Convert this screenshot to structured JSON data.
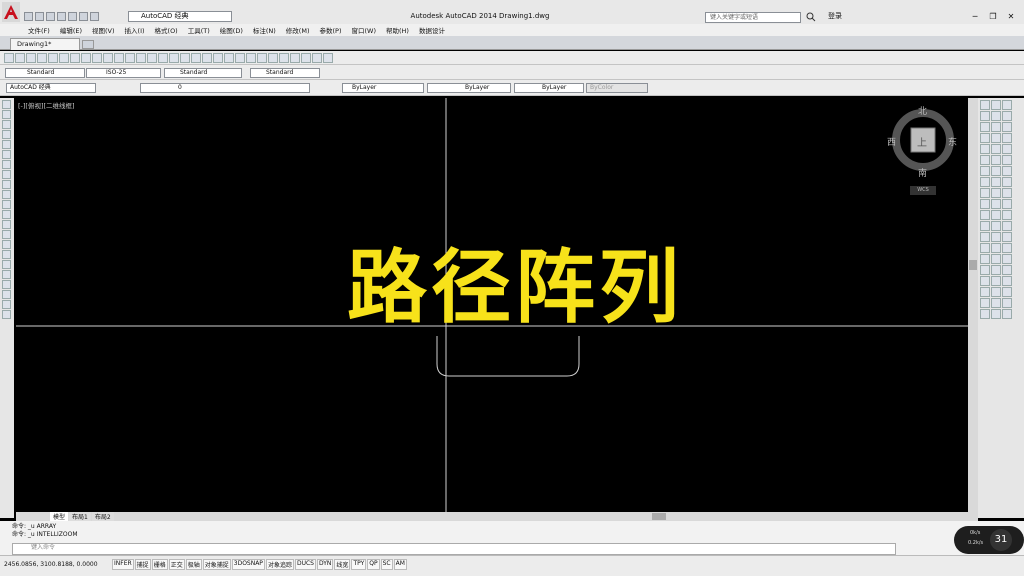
{
  "window": {
    "title": "Autodesk AutoCAD 2014    Drawing1.dwg",
    "workspace": "AutoCAD 经典",
    "help_search_placeholder": "键入关键字或短语",
    "signin_label": "登录",
    "controls": [
      "─",
      "❐",
      "✕"
    ]
  },
  "menu": [
    "文件(F)",
    "编辑(E)",
    "视图(V)",
    "插入(I)",
    "格式(O)",
    "工具(T)",
    "绘图(D)",
    "标注(N)",
    "修改(M)",
    "参数(P)",
    "窗口(W)",
    "帮助(H)",
    "数据设计"
  ],
  "tabs": {
    "document": "Drawing1*"
  },
  "styles": {
    "text_style": "Standard",
    "dim_style": "ISO-25",
    "table_style": "Standard",
    "multileader_style": "Standard"
  },
  "layers": {
    "workspace": "AutoCAD 经典",
    "current_layer": "0",
    "color": "ByLayer",
    "linetype": "ByLayer",
    "lineweight": "ByLayer",
    "plot_style": "ByColor"
  },
  "viewport": {
    "label": "[-][俯视][二维线框]",
    "overlay_text": "路径阵列",
    "viewcube": {
      "north": "北",
      "south": "南",
      "east": "东",
      "west": "西",
      "face": "上",
      "wcs": "WCS"
    }
  },
  "layout_tabs": [
    "模型",
    "布局1",
    "布局2"
  ],
  "command": {
    "history": [
      "命令: _u ARRAY",
      "命令: _u INTELLIZOOM"
    ],
    "prompt": "键入命令"
  },
  "status": {
    "coords": "2456.0856, 3100.8188, 0.0000",
    "toggles": [
      "INFER",
      "捕捉",
      "栅格",
      "正交",
      "极轴",
      "对象捕捉",
      "3DOSNAP",
      "对象追踪",
      "DUCS",
      "DYN",
      "线宽",
      "TPY",
      "QP",
      "SC",
      "AM"
    ]
  },
  "badge": {
    "time": "31",
    "up": "0k/s",
    "down": "0.2k/s"
  },
  "colors": {
    "accent": "#f7e21a",
    "background": "#000000",
    "logo": "#c8101e"
  }
}
